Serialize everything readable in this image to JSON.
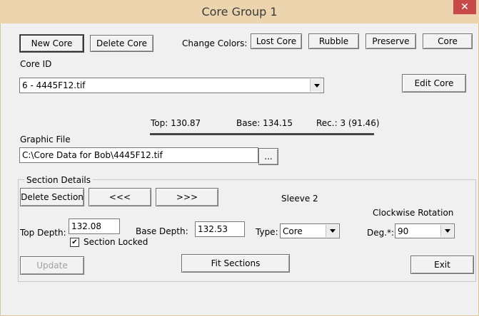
{
  "window": {
    "title": "Core Group 1",
    "close_glyph": "✕"
  },
  "toolbar": {
    "new_core": "New Core",
    "delete_core": "Delete Core",
    "change_colors_label": "Change Colors:",
    "lost_core": "Lost Core",
    "rubble": "Rubble",
    "preserve": "Preserve",
    "core": "Core"
  },
  "core_id": {
    "label": "Core ID",
    "value": "6 - 4445F12.tif",
    "edit_button": "Edit Core"
  },
  "summary": {
    "top": "Top: 130.87",
    "base": "Base: 134.15",
    "rec": "Rec.: 3 (91.46)"
  },
  "graphic_file": {
    "label": "Graphic File",
    "value": "C:\\Core Data for Bob\\4445F12.tif",
    "browse": "..."
  },
  "section_details": {
    "label": "Section Details",
    "delete_section": "Delete Section",
    "prev": "<<<",
    "next": ">>>",
    "sleeve": "Sleeve 2",
    "rotation_label": "Clockwise Rotation",
    "top_depth_label": "Top Depth:",
    "top_depth_value": "132.08",
    "base_depth_label": "Base Depth:",
    "base_depth_value": "132.53",
    "type_label": "Type:",
    "type_value": "Core",
    "deg_label": "Deg.*:",
    "deg_value": "90",
    "section_locked_label": "Section Locked",
    "section_locked_checked": true,
    "check_glyph": "✔",
    "update": "Update",
    "fit_sections": "Fit Sections",
    "exit": "Exit"
  }
}
